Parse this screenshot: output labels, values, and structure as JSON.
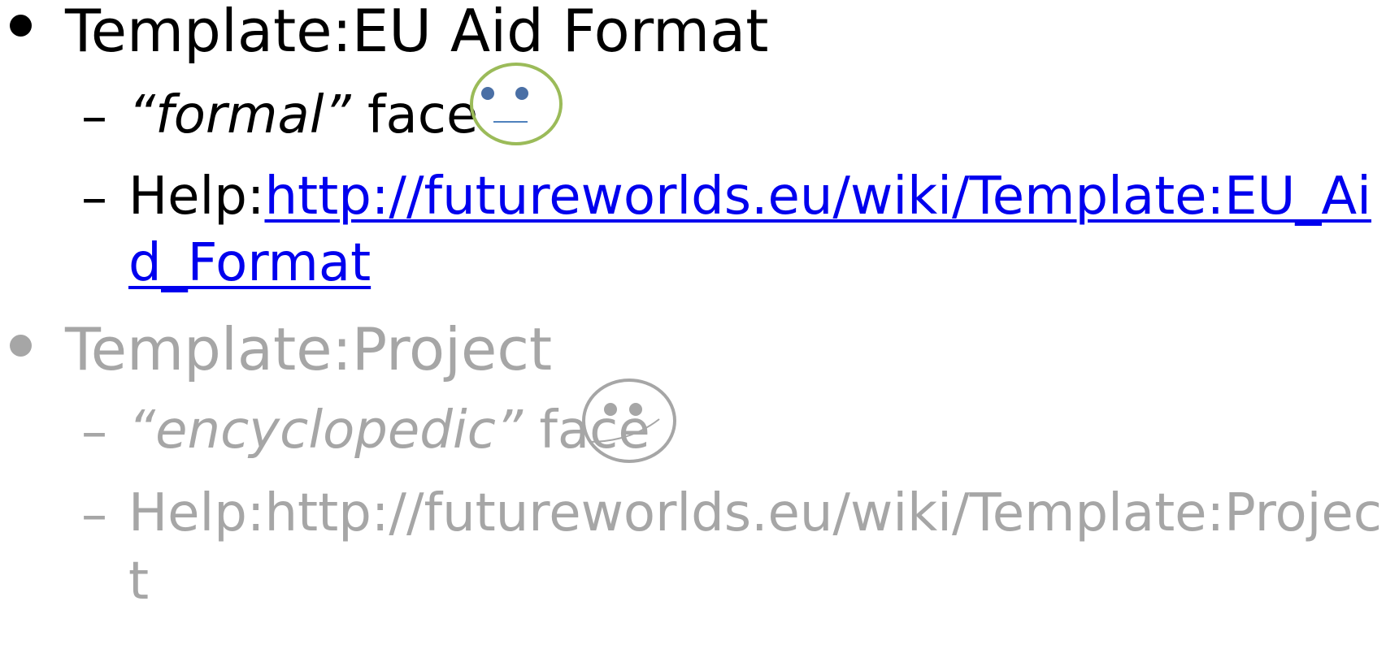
{
  "items": [
    {
      "title": "Template:EU Aid Format",
      "style_prefix_italic": "“formal”",
      "style_suffix": " face",
      "face_icon": "neutral-face-icon",
      "help_prefix": "Help:",
      "help_link_line1": "http://futureworlds.eu/wiki/Template:EU_Ai",
      "help_link_line2": "d_Format"
    },
    {
      "title": "Template:Project",
      "style_prefix_italic": "“encyclopedic”",
      "style_suffix": " face",
      "face_icon": "smiley-face-icon",
      "help_line1": "Help:http://futureworlds.eu/wiki/Template:Projec",
      "help_line2": "t"
    }
  ],
  "dash": "–",
  "colors": {
    "text_active": "#000000",
    "text_dimmed": "#a6a6a6",
    "link": "#0000ee",
    "face_formal_outline": "#9bbb59",
    "face_formal_eyes": "#4a6fa5",
    "face_formal_mouth": "#4f81bd",
    "face_encyclopedic": "#a6a6a6"
  }
}
